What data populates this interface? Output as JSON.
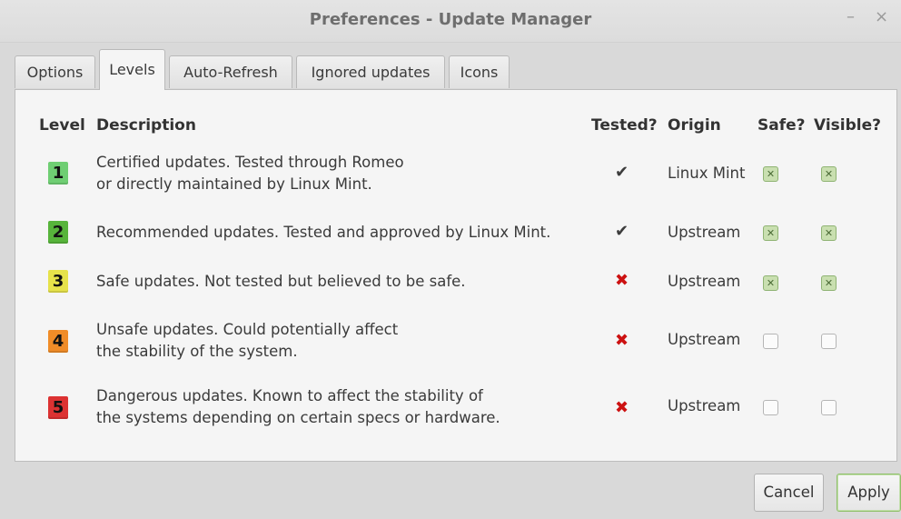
{
  "window": {
    "title": "Preferences - Update Manager",
    "minimize_glyph": "–",
    "close_glyph": "×"
  },
  "tabs": [
    {
      "label": "Options",
      "active": false
    },
    {
      "label": "Levels",
      "active": true
    },
    {
      "label": "Auto-Refresh",
      "active": false
    },
    {
      "label": "Ignored updates",
      "active": false
    },
    {
      "label": "Icons",
      "active": false
    }
  ],
  "columns": {
    "level": "Level",
    "description": "Description",
    "tested": "Tested?",
    "origin": "Origin",
    "safe": "Safe?",
    "visible": "Visible?"
  },
  "levels": [
    {
      "num": "1",
      "color": "#6fce73",
      "desc_line1": "Certified updates. Tested through Romeo",
      "desc_line2": "or directly maintained by Linux Mint.",
      "tested": true,
      "origin": "Linux Mint",
      "safe": true,
      "visible": true
    },
    {
      "num": "2",
      "color": "#57b43b",
      "desc_line1": "Recommended updates. Tested and approved by Linux Mint.",
      "desc_line2": "",
      "tested": true,
      "origin": "Upstream",
      "safe": true,
      "visible": true
    },
    {
      "num": "3",
      "color": "#e6e24a",
      "desc_line1": "Safe updates. Not tested but believed to be safe.",
      "desc_line2": "",
      "tested": false,
      "origin": "Upstream",
      "safe": true,
      "visible": true
    },
    {
      "num": "4",
      "color": "#f08c28",
      "desc_line1": "Unsafe updates. Could potentially affect",
      "desc_line2": "the stability of the system.",
      "tested": false,
      "origin": "Upstream",
      "safe": false,
      "visible": false
    },
    {
      "num": "5",
      "color": "#dc3232",
      "desc_line1": "Dangerous updates. Known to affect the stability of",
      "desc_line2": "the systems depending on certain specs or hardware.",
      "tested": false,
      "origin": "Upstream",
      "safe": false,
      "visible": false
    }
  ],
  "icons": {
    "tested_yes": "✔",
    "tested_no": "✖",
    "checkbox_on": "✕"
  },
  "colors": {
    "check": "#3c3c3c",
    "cross": "#cc1111",
    "checkbox_on": "#c9dfb0"
  },
  "buttons": {
    "cancel": "Cancel",
    "apply": "Apply"
  }
}
